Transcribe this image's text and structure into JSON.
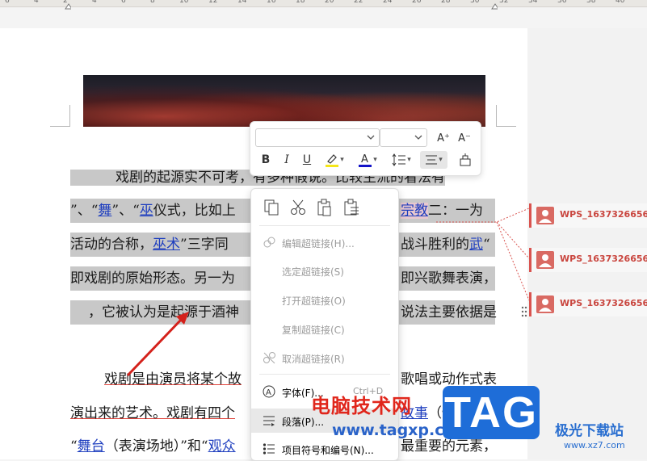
{
  "ruler": {
    "numbers": [
      "6",
      "4",
      "2",
      "4",
      "6",
      "8",
      "10",
      "12",
      "14",
      "16",
      "18",
      "20",
      "22",
      "24",
      "26",
      "28",
      "30",
      "32",
      "34",
      "36",
      "38",
      "40"
    ]
  },
  "document": {
    "lines": [
      {
        "pre": "戏剧的起源实不可考，有多种假说。比较主流的看法有"
      },
      {
        "p1": "”、“",
        "link1": "舞",
        "p2": "”、“",
        "link2": "巫",
        "p3": "仪式，比如上",
        "link3": "宗教",
        "p4": "二：一为"
      },
      {
        "p1": "活动的合称，",
        "link1": "巫术",
        "p2": "”三字同",
        "p3": "战斗胜利的",
        "link2": "武",
        "p4": "“"
      },
      {
        "p1": "即戏剧的原始形态。另一为",
        "p2": "即兴歌舞表演，"
      },
      {
        "p1": "，它被认为是起源于酒神",
        "p2": "说法主要依据是"
      },
      {
        "p1": "戏剧是由演员将某个故",
        "p2": "歌唱或动作式表"
      },
      {
        "p1": "演出来的艺术。戏剧有四个",
        "link1": "故事",
        "p2": "（情节）"
      },
      {
        "p1": "“",
        "link1": "舞台",
        "p2": "（表演场地）”和“",
        "link2": "观众",
        "p3": "最重要的元素，"
      }
    ]
  },
  "mini_toolbar": {
    "font_name": "",
    "font_size": "",
    "grow_font_icon": "A⁺",
    "shrink_font_icon": "A⁻",
    "bold": "B",
    "italic": "I",
    "underline": "U",
    "highlight_color": "#f5e619",
    "font_color": "#1414c8"
  },
  "context_menu": {
    "items": [
      {
        "label": "编辑超链接(H)...",
        "shortcut": "",
        "disabled": true
      },
      {
        "label": "选定超链接(S)",
        "shortcut": "",
        "disabled": true
      },
      {
        "label": "打开超链接(O)",
        "shortcut": "",
        "disabled": true
      },
      {
        "label": "复制超链接(C)",
        "shortcut": "",
        "disabled": true
      },
      {
        "label": "取消超链接(R)",
        "shortcut": "",
        "disabled": true
      },
      {
        "label": "字体(F)...",
        "shortcut": "Ctrl+D",
        "disabled": false
      },
      {
        "label": "段落(P)...",
        "shortcut": "",
        "disabled": false
      },
      {
        "label": "项目符号和编号(N)...",
        "shortcut": "",
        "disabled": false
      }
    ]
  },
  "comments": [
    {
      "author": "WPS_1637326656"
    },
    {
      "author": "WPS_1637326656"
    },
    {
      "author": "WPS_1637326656"
    }
  ],
  "watermark": {
    "cn": "电脑技术网",
    "url": "www.tagxp.com",
    "tag": "TAG",
    "site_cn": "极光下载站",
    "site_url": "www.xz7.com"
  },
  "colors": {
    "accent_red": "#c9453e",
    "link_blue": "#1f3fbf",
    "selection_gray": "#c8c8c8"
  }
}
